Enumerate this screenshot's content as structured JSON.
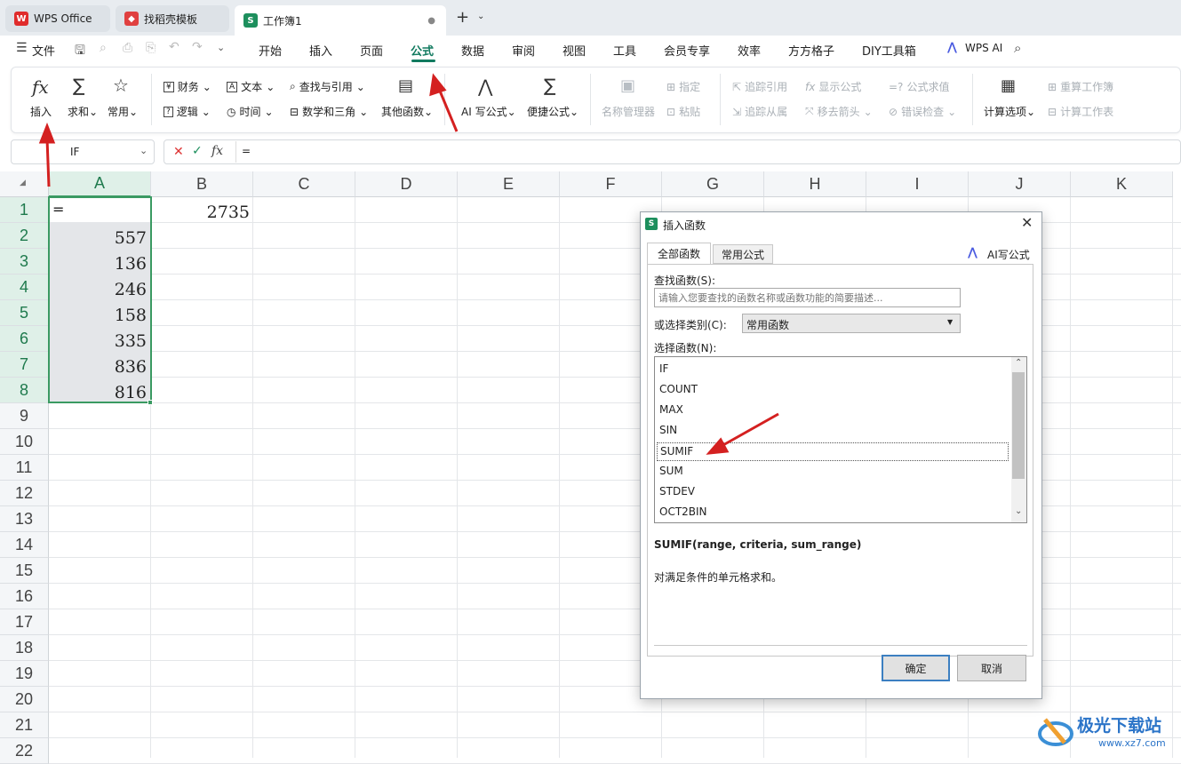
{
  "tabs": [
    {
      "label": "WPS Office",
      "icon": "wps-logo-icon"
    },
    {
      "label": "找稻壳模板",
      "icon": "docer-icon"
    },
    {
      "label": "工作簿1",
      "icon": "sheet-s-icon",
      "active": true
    }
  ],
  "menubar": {
    "file": "文件",
    "items": [
      "开始",
      "插入",
      "页面",
      "公式",
      "数据",
      "审阅",
      "视图",
      "工具",
      "会员专享",
      "效率",
      "方方格子",
      "DIY工具箱"
    ],
    "active": "公式",
    "wps_ai": "WPS AI"
  },
  "ribbon": {
    "insert": "插入",
    "sum": "求和",
    "common": "常用",
    "finance": "财务",
    "text": "文本",
    "lookup": "查找与引用",
    "logic": "逻辑",
    "time": "时间",
    "math": "数学和三角",
    "other": "其他函数",
    "ai_formula": "AI 写公式",
    "quick_formula": "便捷公式",
    "name_mgr": "名称管理器",
    "assign": "指定",
    "paste": "粘贴",
    "trace_prec": "追踪引用",
    "trace_dep": "追踪从属",
    "show_formula": "显示公式",
    "remove_arrows": "移去箭头",
    "eval_formula": "公式求值",
    "error_check": "错误检查",
    "calc_options": "计算选项",
    "recalc_book": "重算工作簿",
    "calc_sheet": "计算工作表"
  },
  "formula_bar": {
    "name_box": "IF",
    "content": "="
  },
  "columns": [
    "A",
    "B",
    "C",
    "D",
    "E",
    "F",
    "G",
    "H",
    "I",
    "J",
    "K"
  ],
  "rows": [
    "1",
    "2",
    "3",
    "4",
    "5",
    "6",
    "7",
    "8",
    "9",
    "10",
    "11",
    "12",
    "13",
    "14",
    "15",
    "16",
    "17",
    "18",
    "19",
    "20",
    "21",
    "22"
  ],
  "cells": {
    "A1": "=",
    "B1": "2735",
    "A_values": [
      "557",
      "136",
      "246",
      "158",
      "335",
      "836",
      "816"
    ]
  },
  "dialog": {
    "title": "插入函数",
    "tab_all": "全部函数",
    "tab_common": "常用公式",
    "ai_link": "AI写公式",
    "search_label": "查找函数(S):",
    "search_placeholder": "请输入您要查找的函数名称或函数功能的简要描述...",
    "category_label": "或选择类别(C):",
    "category_value": "常用函数",
    "select_label": "选择函数(N):",
    "functions": [
      "IF",
      "COUNT",
      "MAX",
      "SIN",
      "SUMIF",
      "SUM",
      "STDEV",
      "OCT2BIN"
    ],
    "selected_function": "SUMIF",
    "signature": "SUMIF(range, criteria, sum_range)",
    "description": "对满足条件的单元格求和。",
    "ok": "确定",
    "cancel": "取消"
  },
  "watermark": "极光下载站",
  "watermark_url": "www.xz7.com",
  "colors": {
    "accent": "#117a5f",
    "selection": "#3a9a62",
    "arrow": "#d42020"
  }
}
